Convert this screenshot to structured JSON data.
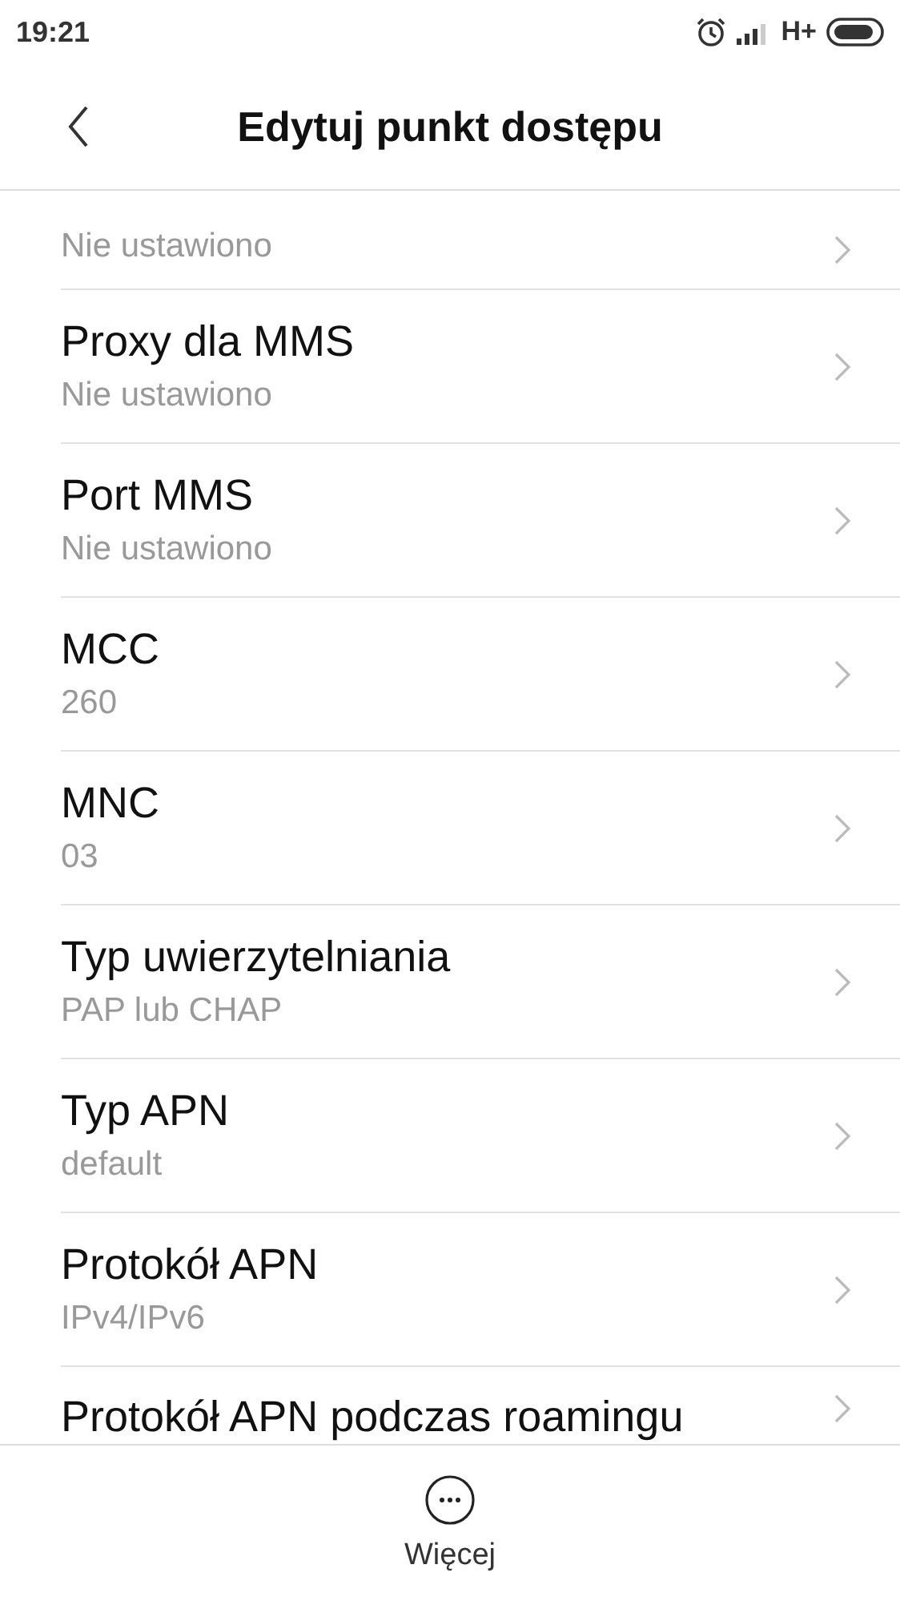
{
  "status_bar": {
    "time": "19:21",
    "network": "H+"
  },
  "header": {
    "title": "Edytuj punkt dostępu"
  },
  "rows": [
    {
      "value": "Nie ustawiono"
    },
    {
      "title": "Proxy dla MMS",
      "value": "Nie ustawiono"
    },
    {
      "title": "Port MMS",
      "value": "Nie ustawiono"
    },
    {
      "title": "MCC",
      "value": "260"
    },
    {
      "title": "MNC",
      "value": "03"
    },
    {
      "title": "Typ uwierzytelniania",
      "value": "PAP lub CHAP"
    },
    {
      "title": "Typ APN",
      "value": "default"
    },
    {
      "title": "Protokół APN",
      "value": "IPv4/IPv6"
    },
    {
      "title": "Protokół APN podczas roamingu"
    }
  ],
  "footer": {
    "label": "Więcej"
  }
}
